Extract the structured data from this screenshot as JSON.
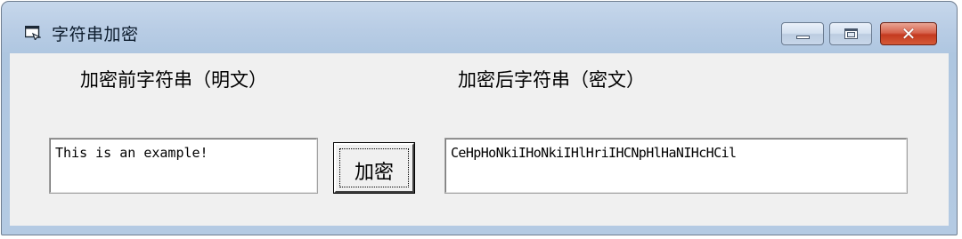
{
  "window": {
    "title": "字符串加密",
    "icon": "app-window-icon",
    "controls": {
      "minimize_icon": "minimize-icon",
      "maximize_icon": "maximize-icon",
      "close_glyph": "✕"
    }
  },
  "form": {
    "plaintext_label": "加密前字符串（明文）",
    "ciphertext_label": "加密后字符串（密文）",
    "plaintext_value": "This is an example!",
    "ciphertext_value": "CeHpHoNkiIHoNkiIHlHriIHCNpHlHaNIHcHCil",
    "encrypt_button_label": "加密"
  },
  "colors": {
    "title_bar": "#b9cde5",
    "client_background": "#f0f0f0",
    "close_button": "#c43a20"
  }
}
